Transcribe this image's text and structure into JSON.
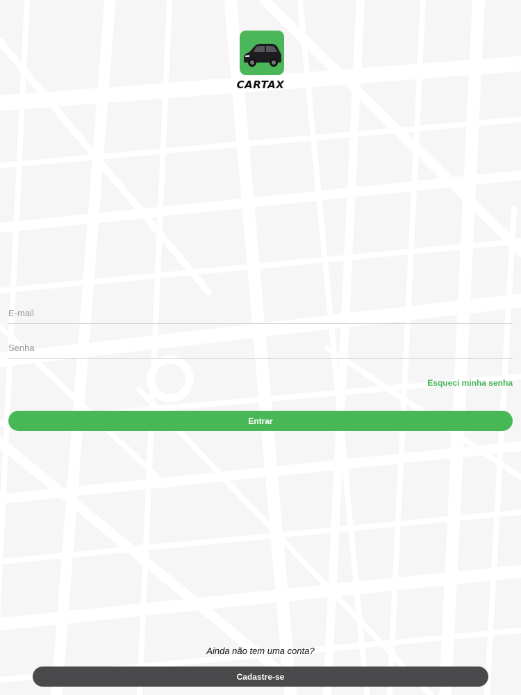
{
  "colors": {
    "accent": "#48b857",
    "secondary_button": "#4a494c",
    "background": "#f6f6f7",
    "map_roads": "#ffffff"
  },
  "logo": {
    "icon": "car-icon",
    "brand": "CARTAX"
  },
  "login": {
    "email_placeholder": "E-mail",
    "password_placeholder": "Senha",
    "forgot_label": "Esqueci minha senha",
    "enter_label": "Entrar"
  },
  "signup": {
    "prompt": "Ainda não tem uma conta?",
    "button_label": "Cadastre-se"
  }
}
